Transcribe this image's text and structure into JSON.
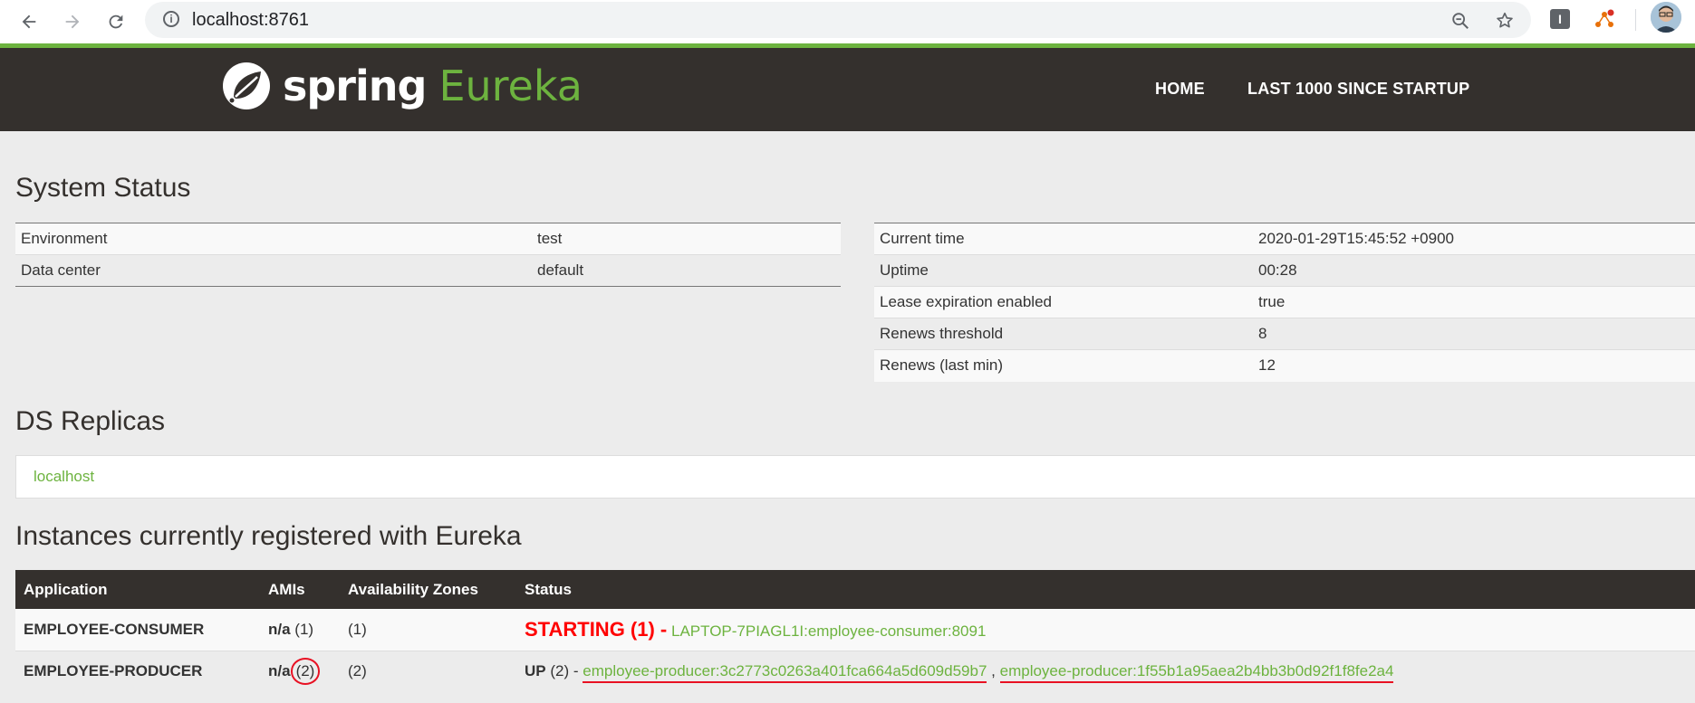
{
  "browser": {
    "url_host": "localhost",
    "url_port": ":8761",
    "ext_i_label": "I",
    "accent_green": "#6db33f"
  },
  "navbar": {
    "logo_spring": "spring",
    "logo_eureka": "Eureka",
    "home_label": "HOME",
    "last1000_label": "LAST 1000 SINCE STARTUP"
  },
  "system_status": {
    "title": "System Status",
    "left": [
      {
        "label": "Environment",
        "value": "test"
      },
      {
        "label": "Data center",
        "value": "default"
      }
    ],
    "right": [
      {
        "label": "Current time",
        "value": "2020-01-29T15:45:52 +0900"
      },
      {
        "label": "Uptime",
        "value": "00:28"
      },
      {
        "label": "Lease expiration enabled",
        "value": "true"
      },
      {
        "label": "Renews threshold",
        "value": "8"
      },
      {
        "label": "Renews (last min)",
        "value": "12"
      }
    ]
  },
  "ds_replicas": {
    "title": "DS Replicas",
    "items": [
      "localhost"
    ]
  },
  "instances": {
    "title": "Instances currently registered with Eureka",
    "headers": [
      "Application",
      "AMIs",
      "Availability Zones",
      "Status"
    ],
    "rows": [
      {
        "application": "EMPLOYEE-CONSUMER",
        "amis_na": "n/a",
        "amis_count": "(1)",
        "zones": "(1)",
        "status_label": "STARTING (1) -",
        "links": [
          "LAPTOP-7PIAGL1I:employee-consumer:8091"
        ]
      },
      {
        "application": "EMPLOYEE-PRODUCER",
        "amis_na": "n/a",
        "amis_count": "(2)",
        "zones": "(2)",
        "status_label": "UP",
        "status_count": "(2) -",
        "links": [
          "employee-producer:3c2773c0263a401fca664a5d609d59b7",
          "employee-producer:1f55b1a95aea2b4bb3b0d92f1f8fe2a4"
        ],
        "separator": ","
      }
    ]
  }
}
